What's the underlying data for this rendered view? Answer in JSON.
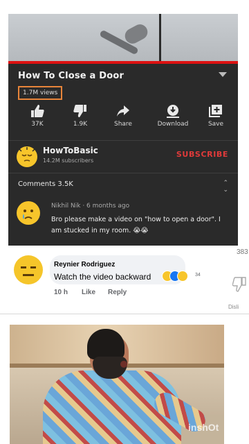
{
  "video": {
    "title": "How To Close a Door",
    "views": "1.7M views",
    "progress_fraction": 1.0,
    "actions": [
      {
        "icon": "thumbs-up-icon",
        "label": "37K"
      },
      {
        "icon": "thumbs-down-icon",
        "label": "1.9K"
      },
      {
        "icon": "share-icon",
        "label": "Share"
      },
      {
        "icon": "download-icon",
        "label": "Download"
      },
      {
        "icon": "save-icon",
        "label": "Save"
      }
    ],
    "channel": {
      "name": "HowToBasic",
      "subs": "14.2M subscribers",
      "subscribe_label": "SUBSCRIBE"
    },
    "comments": {
      "label": "Comments",
      "count": "3.5K",
      "top": {
        "author_line": "Nikhil Nik · 6 months ago",
        "text": "Bro please make a video on \"how to open a door\". I am stucked in my room. 😭😭"
      }
    }
  },
  "fb_comment": {
    "author": "Reynier Rodriguez",
    "text": "Watch the video backward",
    "reaction_count": "34",
    "time": "10 h",
    "like_label": "Like",
    "reply_label": "Reply"
  },
  "side": {
    "count": "383",
    "dislike_label": "Disli"
  },
  "watermark": "inshOt",
  "colors": {
    "yt_bg": "#2a2a2a",
    "subscribe": "#e03a3a",
    "views_box": "#e8853a",
    "progress": "#dd1111"
  }
}
